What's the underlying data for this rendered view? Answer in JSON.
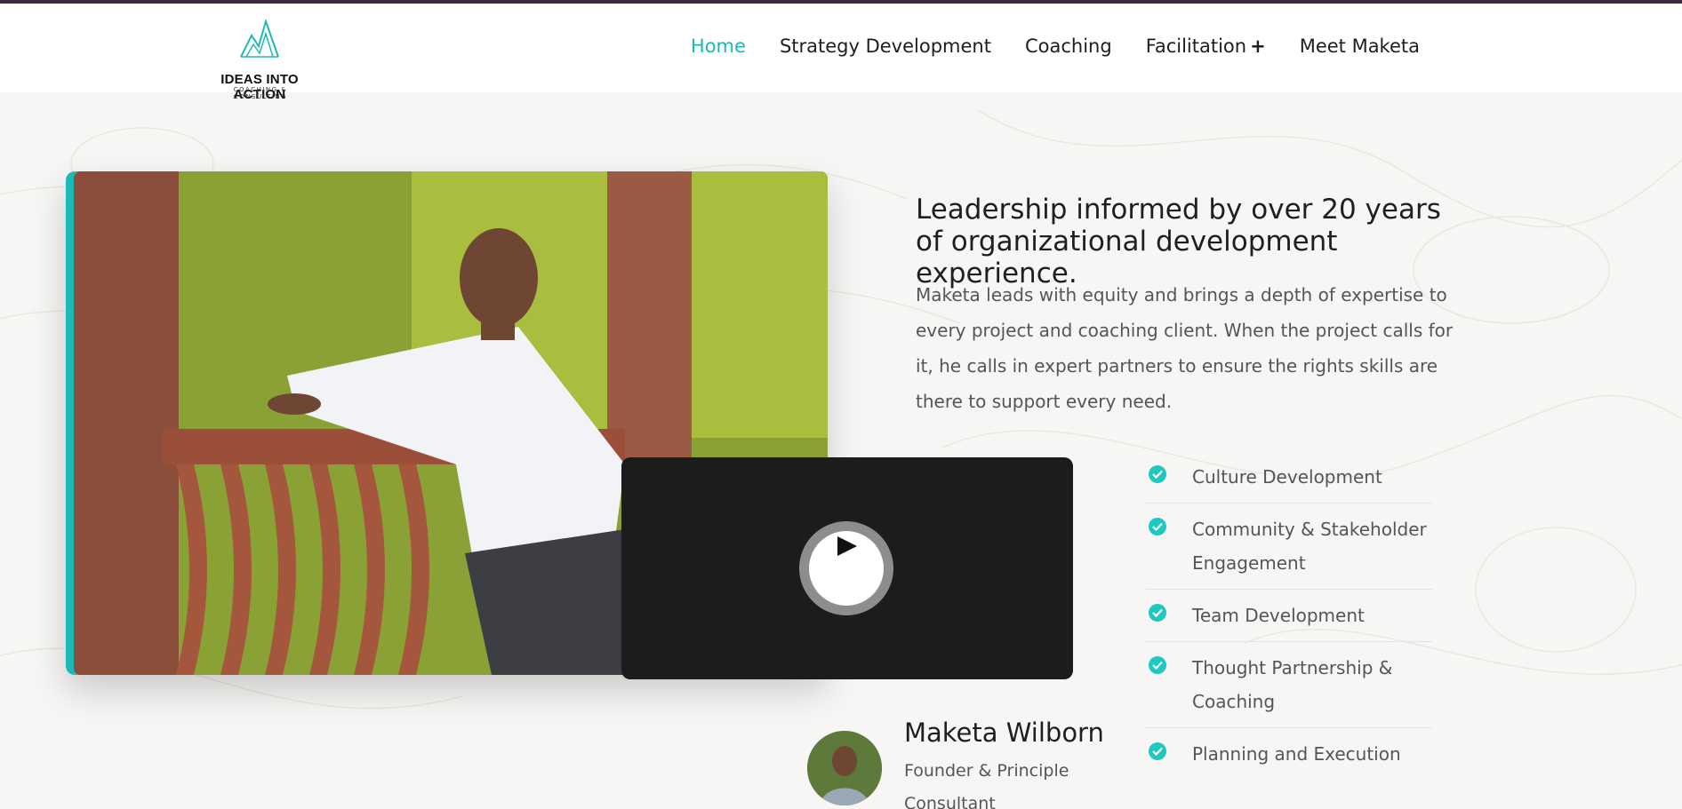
{
  "logo": {
    "brand": "IDEAS INTO ACTION",
    "tagline": "COACHING & CONSULTING",
    "icon": "mountain-logo-icon",
    "accent_color": "#1fb8b5"
  },
  "nav": {
    "items": [
      {
        "label": "Home",
        "active": true
      },
      {
        "label": "Strategy Development"
      },
      {
        "label": "Coaching"
      },
      {
        "label": "Facilitation",
        "suffix": "+"
      },
      {
        "label": "Meet Maketa"
      }
    ]
  },
  "hero": {
    "headline": "Leadership informed by over 20 years of organizational development experience.",
    "lead": "Maketa leads with equity and brings a depth of expertise to every project and coaching client. When the project calls for it, he calls in expert partners to ensure the rights skills are there to support every need."
  },
  "video": {
    "icon": "play-icon"
  },
  "services": [
    "Culture Development",
    "Community & Stakeholder Engagement",
    "Team Development",
    "Thought Partnership & Coaching",
    "Planning and Execution"
  ],
  "profile": {
    "name": "Maketa Wilborn",
    "role": "Founder & Principle Consultant"
  },
  "colors": {
    "accent": "#1fb8b5",
    "check": "#1fc7c1",
    "topbar": "#3c2a3e",
    "background": "#f7f6f4"
  }
}
